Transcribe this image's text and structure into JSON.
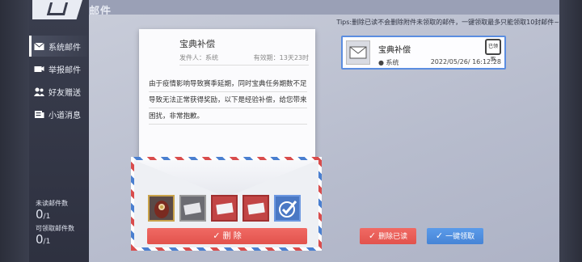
{
  "header": {
    "section_title": "邮件"
  },
  "sidebar": {
    "items": [
      {
        "label": "系统邮件",
        "icon": "envelope-icon",
        "active": true
      },
      {
        "label": "举报邮件",
        "icon": "report-icon",
        "active": false
      },
      {
        "label": "好友赠送",
        "icon": "friends-icon",
        "active": false
      },
      {
        "label": "小道消息",
        "icon": "news-icon",
        "active": false
      }
    ],
    "unread_label": "未读邮件数",
    "unread_count": "0",
    "unread_total": "/1",
    "claimable_label": "可领取邮件数",
    "claimable_count": "0",
    "claimable_total": "/1"
  },
  "tips": "Tips:删除已读不会删除附件未领取的邮件，一键领取最多只能领取10封邮件~",
  "letter": {
    "title": "宝典补偿",
    "sender_label": "发件人：系统",
    "validity_label": "有效期：13天23时",
    "body": "由于疫情影响导致赛季延期，同时宝典任务期数不足导致无法正常获得奖励，以下是经验补偿，给您带来困扰，非常抱歉。"
  },
  "attachments": [
    {
      "name": "doll-item",
      "style": "gold"
    },
    {
      "name": "card-item-grey",
      "style": "grey"
    },
    {
      "name": "card-item-red-1",
      "style": "red"
    },
    {
      "name": "card-item-red-2",
      "style": "red"
    },
    {
      "name": "check-item",
      "style": "blue"
    }
  ],
  "buttons": {
    "delete": "删 除",
    "delete_read": "删除已读",
    "claim_all": "一键领取"
  },
  "mail_list": [
    {
      "title": "宝典补偿",
      "sender": "系统",
      "time": "2022/05/26/ 16:12:28",
      "stamp": "已领取"
    }
  ],
  "colors": {
    "accent_blue": "#5b8de0",
    "danger_red": "#e2524c"
  }
}
